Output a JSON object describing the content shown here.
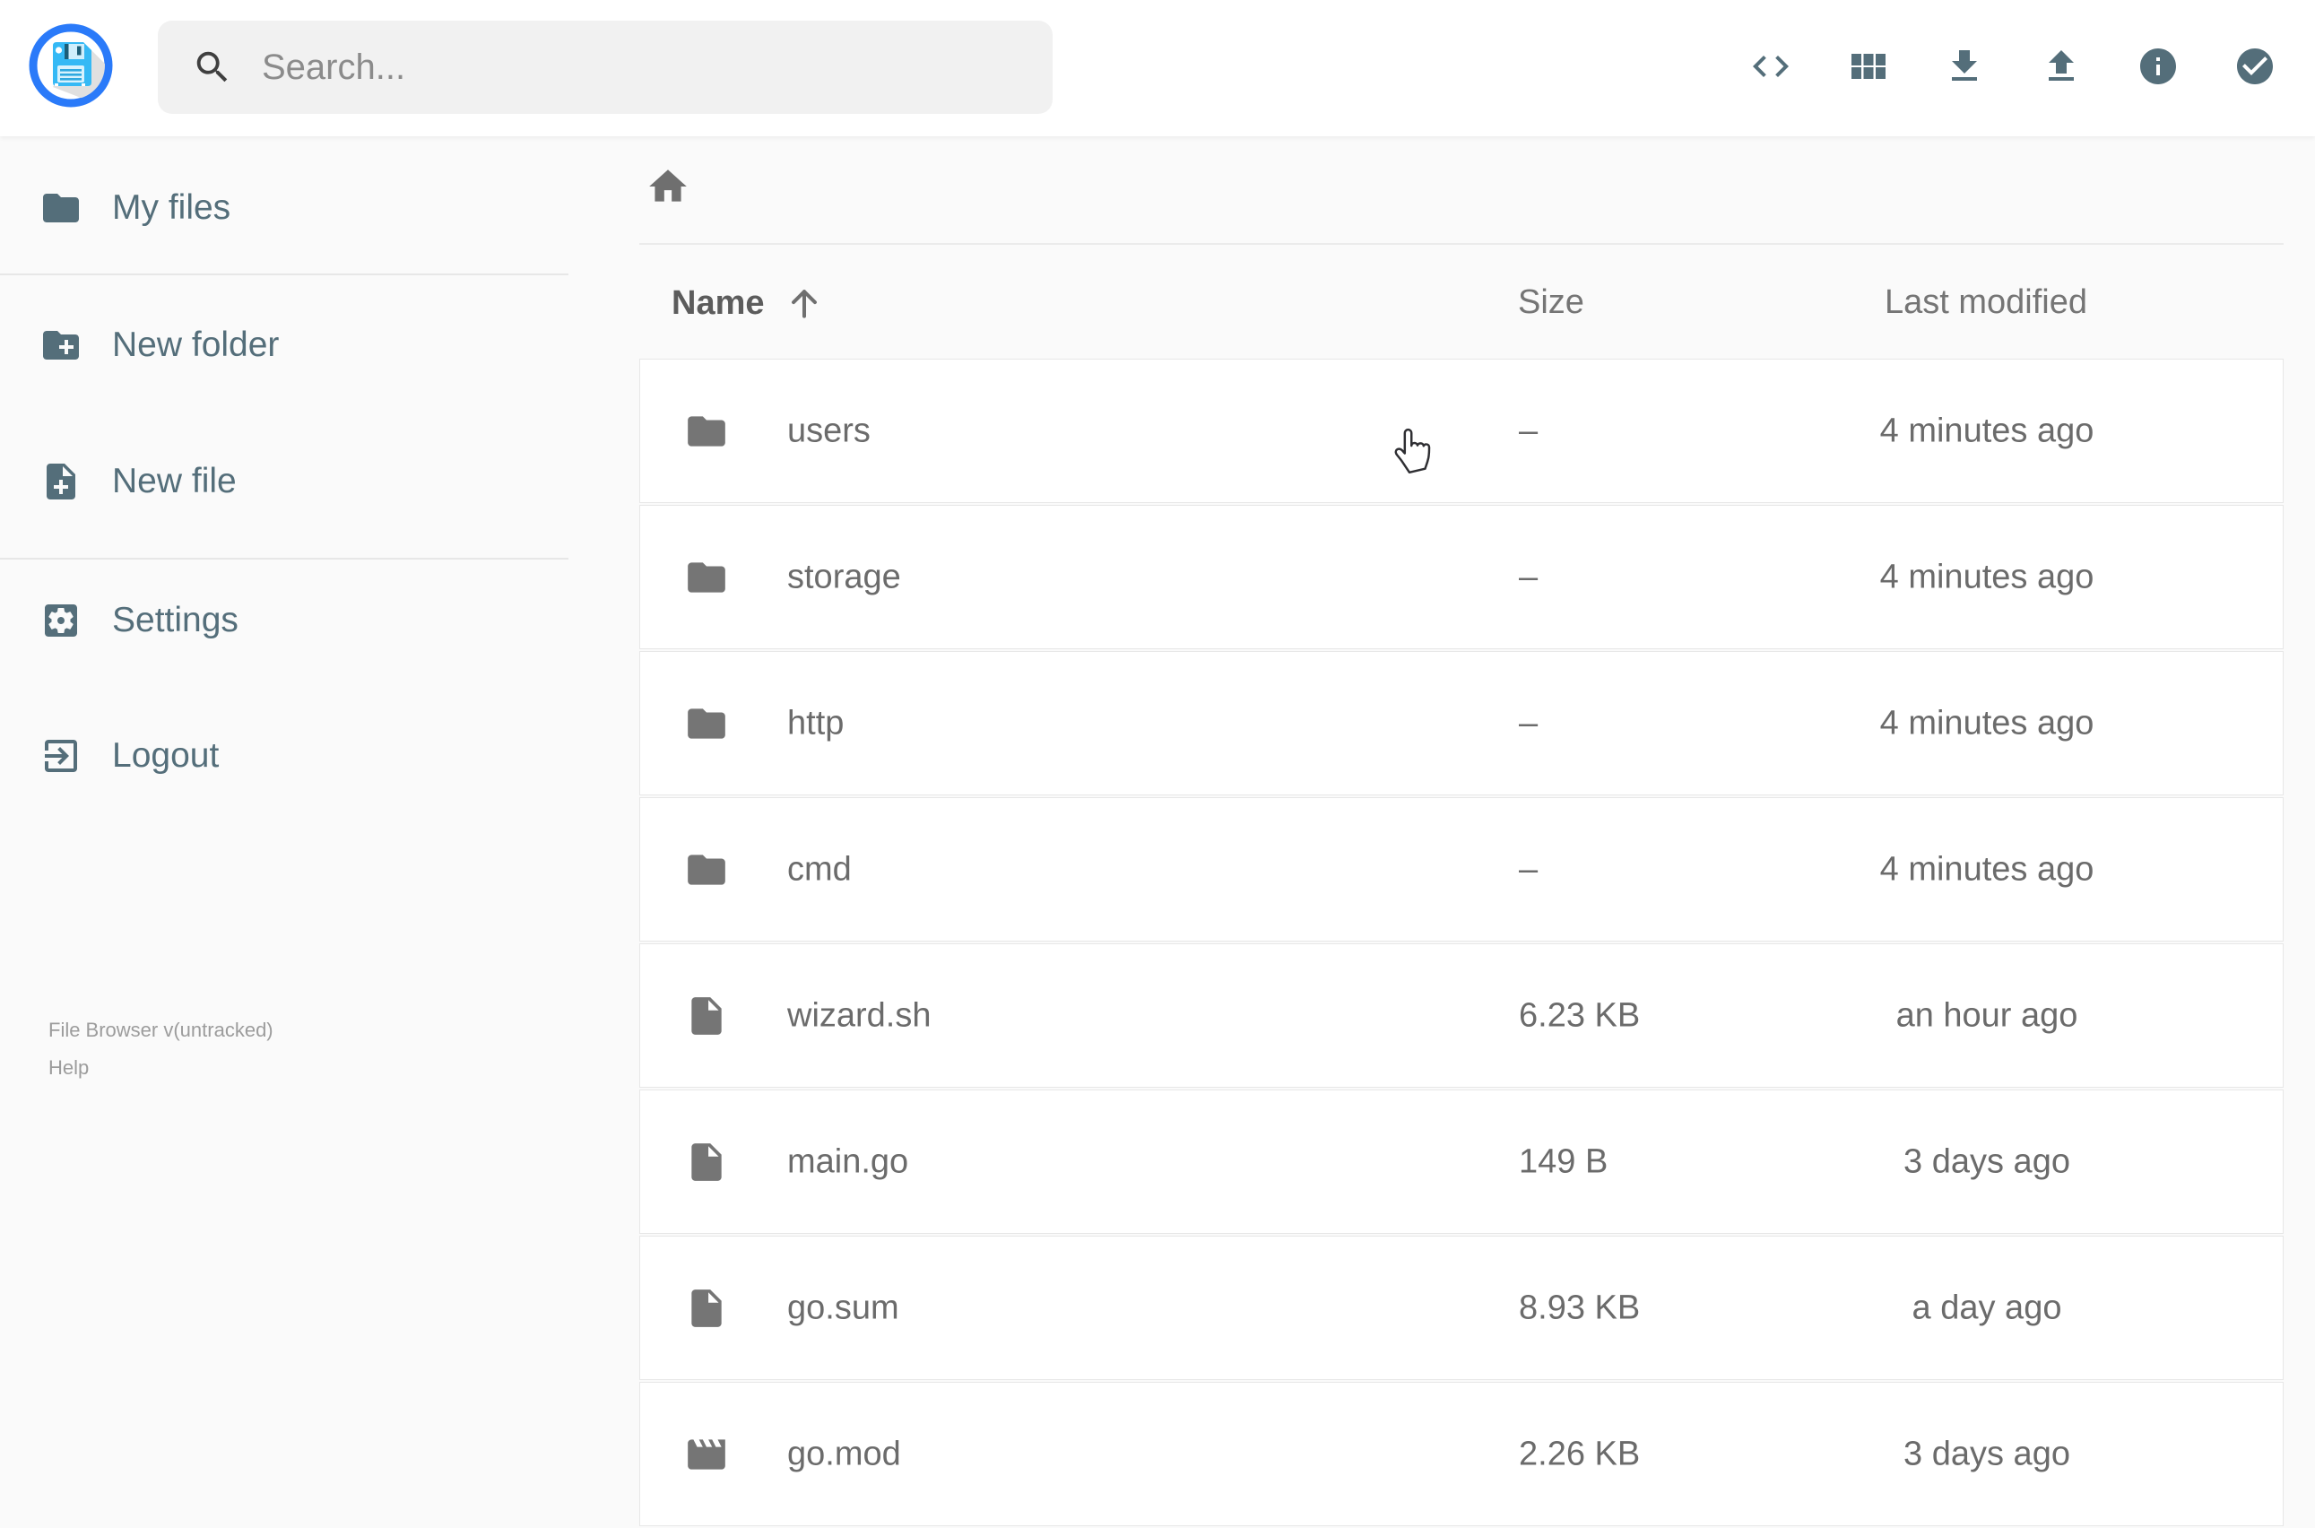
{
  "header": {
    "logo": "file-browser-floppy-logo",
    "search": {
      "placeholder": "Search..."
    },
    "action_icons": [
      "code",
      "view-grid",
      "download",
      "upload",
      "info",
      "check-circle"
    ]
  },
  "sidebar": {
    "items": [
      {
        "label": "My files",
        "icon": "folder"
      },
      {
        "label": "New folder",
        "icon": "new-folder"
      },
      {
        "label": "New file",
        "icon": "new-file"
      },
      {
        "label": "Settings",
        "icon": "settings"
      },
      {
        "label": "Logout",
        "icon": "logout"
      }
    ],
    "footer": {
      "version": "File Browser v(untracked)",
      "help": "Help"
    }
  },
  "breadcrumb": {
    "home_icon": "home"
  },
  "listing": {
    "columns": {
      "name": "Name",
      "size": "Size",
      "modified": "Last modified"
    },
    "sort": {
      "column": "Name",
      "direction": "ascending"
    },
    "rows": [
      {
        "name": "users",
        "type": "folder",
        "size": "–",
        "modified": "4 minutes ago"
      },
      {
        "name": "storage",
        "type": "folder",
        "size": "–",
        "modified": "4 minutes ago"
      },
      {
        "name": "http",
        "type": "folder",
        "size": "–",
        "modified": "4 minutes ago"
      },
      {
        "name": "cmd",
        "type": "folder",
        "size": "–",
        "modified": "4 minutes ago"
      },
      {
        "name": "wizard.sh",
        "type": "file",
        "size": "6.23 KB",
        "modified": "an hour ago"
      },
      {
        "name": "main.go",
        "type": "file",
        "size": "149 B",
        "modified": "3 days ago"
      },
      {
        "name": "go.sum",
        "type": "file",
        "size": "8.93 KB",
        "modified": "a day ago"
      },
      {
        "name": "go.mod",
        "type": "movie",
        "size": "2.26 KB",
        "modified": "3 days ago"
      }
    ]
  },
  "colors": {
    "accent_blue": "#2A7AF9",
    "floppy_blue": "#35B9F5",
    "slate_icon": "#546E7A",
    "row_text": "#6B6B6B",
    "muted_text": "#9C9C9C",
    "page_bg": "#FAFAFA"
  },
  "cursor": {
    "type": "hand-pointer"
  }
}
